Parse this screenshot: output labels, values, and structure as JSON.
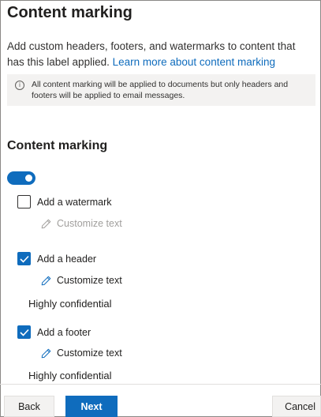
{
  "header": {
    "title": "Content marking",
    "description": "Add custom headers, footers, and watermarks to content that has this label applied.",
    "learn_more_link": "Learn more about content marking"
  },
  "info_bar": {
    "icon": "info-icon",
    "text": "All content marking will be applied to documents but only headers and footers will be applied to email messages."
  },
  "section": {
    "title": "Content marking",
    "toggle_on": true
  },
  "options": {
    "watermark": {
      "label": "Add a watermark",
      "checked": false,
      "customize_label": "Customize text"
    },
    "header": {
      "label": "Add a header",
      "checked": true,
      "customize_label": "Customize text",
      "value": "Highly confidential"
    },
    "footer": {
      "label": "Add a footer",
      "checked": true,
      "customize_label": "Customize text",
      "value": "Highly confidential"
    }
  },
  "buttons": {
    "back": "Back",
    "next": "Next",
    "cancel": "Cancel"
  },
  "colors": {
    "accent": "#0f6cbd",
    "info_bg": "#f3f2f1",
    "disabled_text": "#a19f9d"
  }
}
